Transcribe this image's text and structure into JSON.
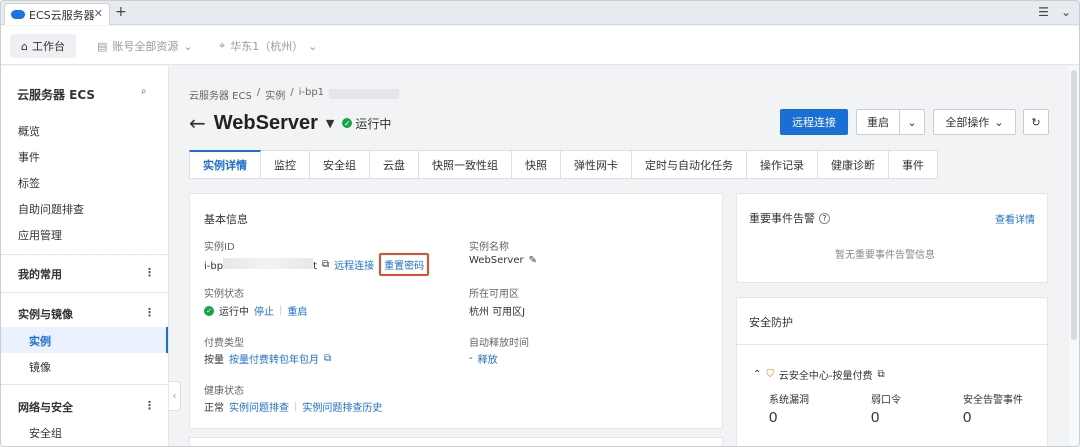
{
  "browser": {
    "tab_title": "ECS云服务器",
    "tab_close": "✕",
    "new_tab": "+"
  },
  "topbar": {
    "home_label": "工作台",
    "account_label": "账号全部资源",
    "region_label": "华东1（杭州）"
  },
  "sidebar": {
    "title": "云服务器 ECS",
    "items": [
      "概览",
      "事件",
      "标签",
      "自助问题排查",
      "应用管理"
    ],
    "sections": [
      {
        "label": "我的常用"
      },
      {
        "label": "实例与镜像",
        "children": [
          "实例",
          "镜像"
        ]
      },
      {
        "label": "网络与安全",
        "children": [
          "安全组"
        ]
      }
    ]
  },
  "breadcrumb": [
    "云服务器 ECS",
    "/",
    "实例",
    "/",
    "i-bp1"
  ],
  "header": {
    "title": "WebServer",
    "status": "运行中"
  },
  "actions": {
    "remote": "远程连接",
    "restart": "重启",
    "all_ops": "全部操作"
  },
  "tabs": [
    "实例详情",
    "监控",
    "安全组",
    "云盘",
    "快照一致性组",
    "快照",
    "弹性网卡",
    "定时与自动化任务",
    "操作记录",
    "健康诊断",
    "事件"
  ],
  "basic": {
    "title": "基本信息",
    "instance_id_label": "实例ID",
    "instance_id_prefix": "i-bp",
    "instance_id_suffix": "t",
    "remote_link": "远程连接",
    "reset_pwd": "重置密码",
    "instance_name_label": "实例名称",
    "instance_name": "WebServer",
    "status_label": "实例状态",
    "status": "运行中",
    "stop": "停止",
    "restart": "重启",
    "zone_label": "所在可用区",
    "zone": "杭州 可用区J",
    "billing_label": "付费类型",
    "billing": "按量",
    "billing_link": "按量付费转包年包月",
    "release_label": "自动释放时间",
    "release_dash": "-",
    "release_link": "释放",
    "health_label": "健康状态",
    "health": "正常",
    "health_link1": "实例问题排查",
    "health_link2": "实例问题排查历史"
  },
  "events": {
    "title": "重要事件告警",
    "view_details": "查看详情",
    "empty": "暂无重要事件告警信息"
  },
  "security": {
    "title": "安全防护",
    "center": "云安全中心-按量付费",
    "metrics": [
      {
        "label": "系统漏洞",
        "value": "0"
      },
      {
        "label": "弱口令",
        "value": "0"
      },
      {
        "label": "安全告警事件",
        "value": "0"
      }
    ]
  }
}
